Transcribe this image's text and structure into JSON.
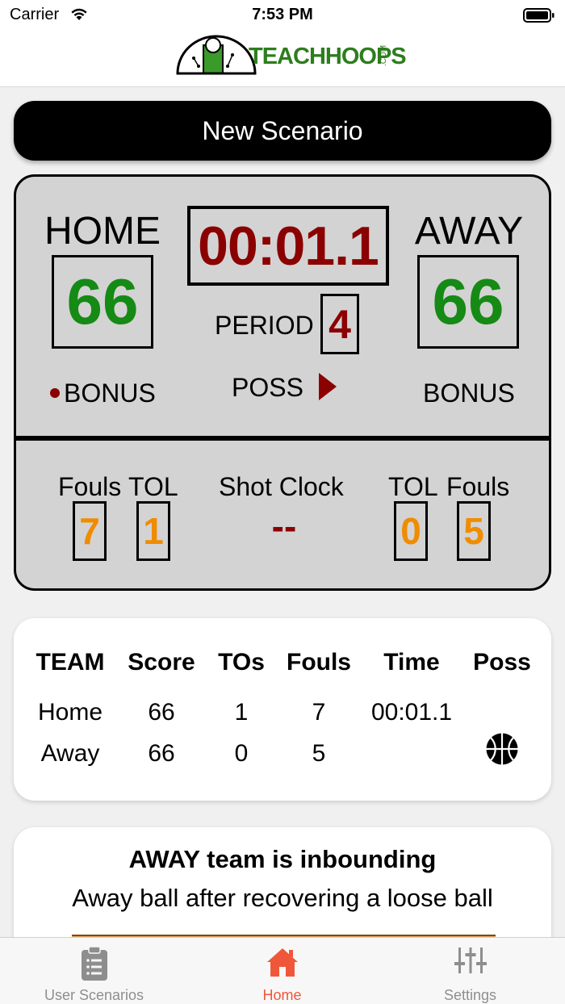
{
  "status_bar": {
    "carrier": "Carrier",
    "time": "7:53 PM"
  },
  "header": {
    "logo_text": "TEACHHOOPS",
    "logo_suffix": ".COM"
  },
  "new_scenario_label": "New Scenario",
  "scoreboard": {
    "home_label": "HOME",
    "away_label": "AWAY",
    "home_score": "66",
    "away_score": "66",
    "game_clock": "00:01.1",
    "period_label": "PERIOD",
    "period": "4",
    "poss_label": "POSS",
    "possession_arrow": "right",
    "home_bonus": "BONUS",
    "home_bonus_active": true,
    "away_bonus": "BONUS",
    "away_bonus_active": false,
    "home_fouls_label": "Fouls",
    "home_tol_label": "TOL",
    "shot_clock_label": "Shot Clock",
    "away_tol_label": "TOL",
    "away_fouls_label": "Fouls",
    "home_fouls": "7",
    "home_tol": "1",
    "shot_clock": "--",
    "away_tol": "0",
    "away_fouls": "5"
  },
  "stats_table": {
    "headers": [
      "TEAM",
      "Score",
      "TOs",
      "Fouls",
      "Time",
      "Poss"
    ],
    "rows": [
      {
        "team": "Home",
        "score": "66",
        "tos": "1",
        "fouls": "7",
        "time": "00:01.1",
        "poss": ""
      },
      {
        "team": "Away",
        "score": "66",
        "tos": "0",
        "fouls": "5",
        "time": "",
        "poss": "basketball-icon"
      }
    ]
  },
  "info_card": {
    "title": "AWAY team is inbounding",
    "subtitle": "Away ball after recovering a loose ball"
  },
  "tab_bar": {
    "tabs": [
      {
        "label": "User Scenarios",
        "icon": "clipboard-list-icon",
        "active": false
      },
      {
        "label": "Home",
        "icon": "home-icon",
        "active": true
      },
      {
        "label": "Settings",
        "icon": "sliders-icon",
        "active": false
      }
    ]
  },
  "colors": {
    "score_green": "#158a15",
    "clock_red": "#8b0000",
    "count_orange": "#f08c00",
    "tab_active": "#f0573a",
    "logo_green": "#2e7d1e"
  }
}
